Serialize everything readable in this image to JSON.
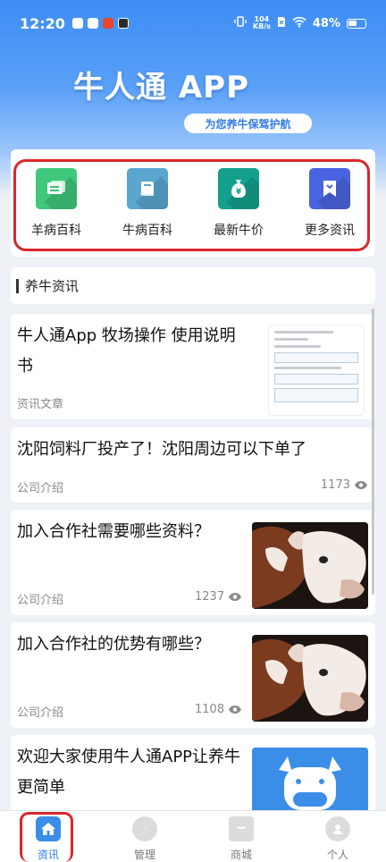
{
  "status_bar": {
    "time": "12:20",
    "net_speed_value": "104",
    "net_speed_unit": "KB/s",
    "battery": "48%"
  },
  "header": {
    "title": "牛人通 APP",
    "slogan": "为您养牛保驾护航"
  },
  "quick_links": [
    {
      "label": "羊病百科",
      "icon": "book-stack-icon",
      "color": "#3fc77c"
    },
    {
      "label": "牛病百科",
      "icon": "book-icon",
      "color": "#5aa6cf"
    },
    {
      "label": "最新牛价",
      "icon": "money-bag-icon",
      "color": "#13a08d"
    },
    {
      "label": "更多资讯",
      "icon": "bookmark-icon",
      "color": "#4a63e0"
    }
  ],
  "section": {
    "title": "养牛资讯"
  },
  "news": [
    {
      "title": "牛人通App 牧场操作  使用说明书",
      "category": "资讯文章",
      "views": ""
    },
    {
      "title": "沈阳饲料厂投产了！沈阳周边可以下单了",
      "category": "公司介绍",
      "views": "1173"
    },
    {
      "title": "加入合作社需要哪些资料？",
      "category": "公司介绍",
      "views": "1237"
    },
    {
      "title": "加入合作社的优势有哪些？",
      "category": "公司介绍",
      "views": "1108"
    },
    {
      "title": "欢迎大家使用牛人通APP让养牛更简单",
      "category": "",
      "views": ""
    }
  ],
  "tabbar": [
    {
      "label": "资讯",
      "icon": "home-icon",
      "active": true
    },
    {
      "label": "管理",
      "icon": "compass-icon",
      "active": false
    },
    {
      "label": "商城",
      "icon": "shop-icon",
      "active": false
    },
    {
      "label": "个人",
      "icon": "user-icon",
      "active": false
    }
  ],
  "colors": {
    "accent": "#2f7de6",
    "highlight": "#d9262c"
  }
}
